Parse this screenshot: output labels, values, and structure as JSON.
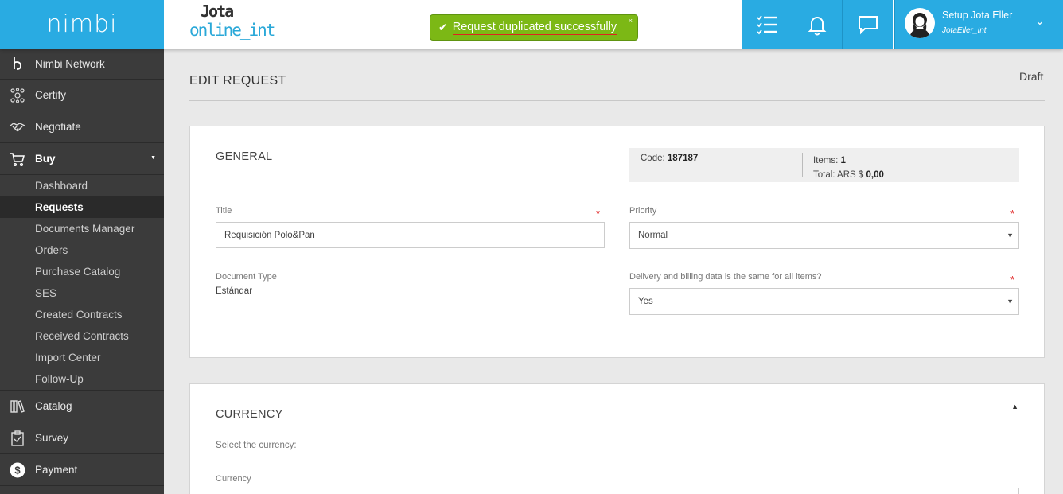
{
  "brand": {
    "name": "nimbi"
  },
  "client_logo": {
    "line1": "Jota",
    "line2": "online_int"
  },
  "toast": {
    "message": "Request duplicated successfully",
    "close": "×"
  },
  "topbar": {
    "icons": [
      "task-list-icon",
      "bell-icon",
      "chat-icon"
    ]
  },
  "user": {
    "name": "Setup Jota Eller",
    "username": "JotaEller_Int"
  },
  "sidebar": {
    "items": [
      {
        "label": "Nimbi Network",
        "icon": "nimbi-network-icon"
      },
      {
        "label": "Certify",
        "icon": "certify-icon"
      },
      {
        "label": "Negotiate",
        "icon": "handshake-icon"
      },
      {
        "label": "Buy",
        "icon": "cart-icon"
      },
      {
        "label": "Catalog",
        "icon": "books-icon"
      },
      {
        "label": "Survey",
        "icon": "clipboard-icon"
      },
      {
        "label": "Payment",
        "icon": "dollar-icon"
      }
    ],
    "buy_sub": [
      "Dashboard",
      "Requests",
      "Documents Manager",
      "Orders",
      "Purchase Catalog",
      "SES",
      "Created Contracts",
      "Received Contracts",
      "Import Center",
      "Follow-Up"
    ]
  },
  "page": {
    "title": "EDIT REQUEST",
    "status": "Draft"
  },
  "general": {
    "title": "GENERAL",
    "code_label": "Code:",
    "code_value": "187187",
    "items_label": "Items:",
    "items_value": "1",
    "total_label": "Total: ARS $",
    "total_value": "0,00",
    "title_label": "Title",
    "title_value": "Requisición Polo&Pan",
    "priority_label": "Priority",
    "priority_value": "Normal",
    "doctype_label": "Document Type",
    "doctype_value": "Estándar",
    "delivery_label": "Delivery and billing data is the same for all items?",
    "delivery_value": "Yes",
    "required_mark": "*"
  },
  "currency": {
    "title": "CURRENCY",
    "hint": "Select the currency:",
    "currency_label": "Currency"
  }
}
